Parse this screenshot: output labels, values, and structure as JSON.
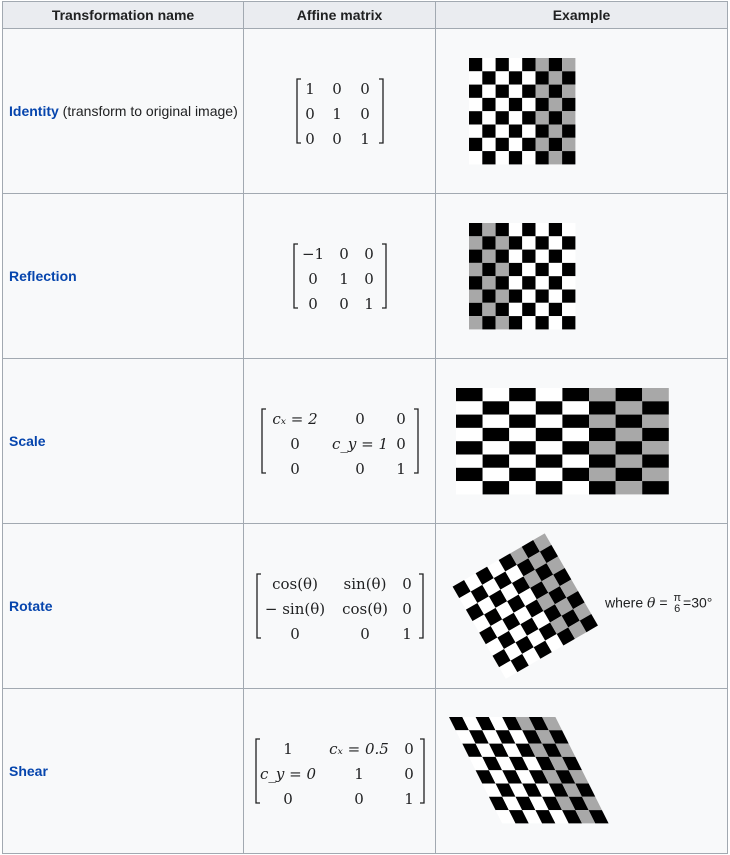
{
  "headers": {
    "name": "Transformation name",
    "matrix": "Affine matrix",
    "example": "Example"
  },
  "rows": [
    {
      "name": "Identity",
      "suffix": "(transform to original image)",
      "matrix": [
        [
          "1",
          "0",
          "0"
        ],
        [
          "0",
          "1",
          "0"
        ],
        [
          "0",
          "0",
          "1"
        ]
      ]
    },
    {
      "name": "Reflection",
      "suffix": "",
      "matrix": [
        [
          "−1",
          "0",
          "0"
        ],
        [
          "0",
          "1",
          "0"
        ],
        [
          "0",
          "0",
          "1"
        ]
      ]
    },
    {
      "name": "Scale",
      "suffix": "",
      "matrix": [
        [
          "cₓ = 2",
          "0",
          "0"
        ],
        [
          "0",
          "c_y = 1",
          "0"
        ],
        [
          "0",
          "0",
          "1"
        ]
      ]
    },
    {
      "name": "Rotate",
      "suffix": "",
      "matrix": [
        [
          "cos(θ)",
          "sin(θ)",
          "0"
        ],
        [
          "− sin(θ)",
          "cos(θ)",
          "0"
        ],
        [
          "0",
          "0",
          "1"
        ]
      ],
      "note": {
        "prefix": "where",
        "symbol": "θ",
        "equals": "=",
        "numerator": "π",
        "denominator": "6",
        "result": "=30°"
      }
    },
    {
      "name": "Shear",
      "suffix": "",
      "matrix": [
        [
          "1",
          "cₓ = 0.5",
          "0"
        ],
        [
          "c_y = 0",
          "1",
          "0"
        ],
        [
          "0",
          "0",
          "1"
        ]
      ]
    }
  ],
  "colors": {
    "link": "#0645ad",
    "header_bg": "#eaecf0",
    "cell_bg": "#f8f9fa",
    "border": "#a2a9b1",
    "black_square": "#000000",
    "gray_square": "#a8a8a8",
    "white_square": "#ffffff"
  }
}
